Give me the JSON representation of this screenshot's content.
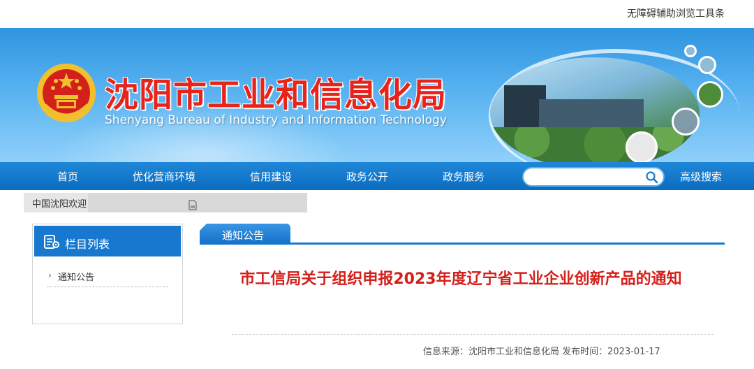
{
  "topbar": {
    "accessibility_toolbar": "无障碍辅助浏览工具条"
  },
  "header": {
    "title_cn": "沈阳市工业和信息化局",
    "title_en": "Shenyang Bureau of Industry and Information Technology"
  },
  "nav": {
    "items": [
      "首页",
      "优化营商环境",
      "信用建设",
      "政务公开",
      "政务服务"
    ],
    "search_placeholder": "",
    "advanced_search": "高级搜索"
  },
  "welcome": {
    "text": "中国沈阳欢迎"
  },
  "sidebar": {
    "title": "栏目列表",
    "items": [
      {
        "label": "通知公告"
      }
    ]
  },
  "content": {
    "tab_label": "通知公告",
    "article_title": "市工信局关于组织申报2023年度辽宁省工业企业创新产品的通知",
    "meta": "信息来源：沈阳市工业和信息化局 发布时间：2023-01-17"
  },
  "colors": {
    "primary_blue": "#1878cf",
    "title_red": "#e8231a",
    "article_red": "#d3201b"
  }
}
